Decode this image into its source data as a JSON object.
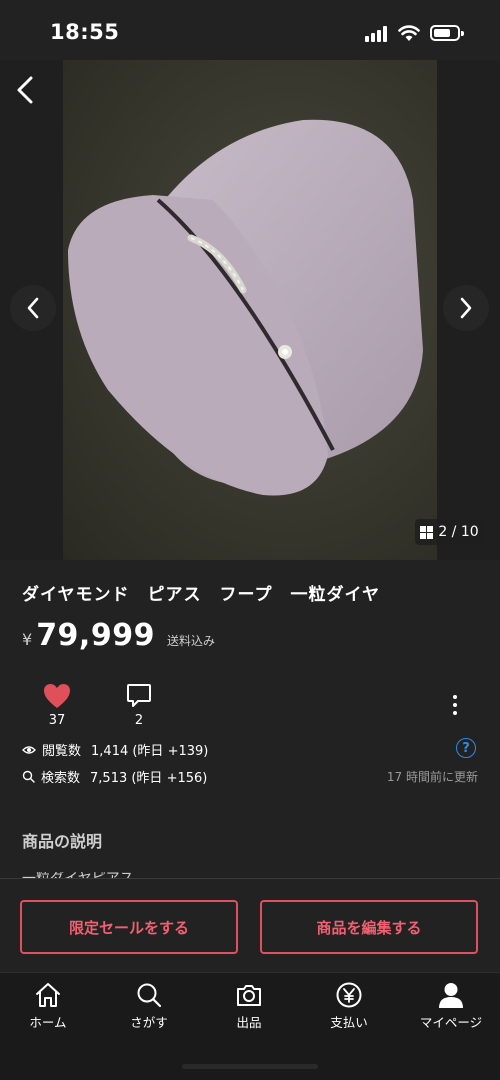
{
  "status_bar": {
    "time": "18:55"
  },
  "gallery": {
    "counter": "2 / 10"
  },
  "item": {
    "title": "ダイヤモンド　ピアス　フープ　一粒ダイヤ",
    "currency": "¥",
    "price": "79,999",
    "shipping": "送料込み"
  },
  "stats": {
    "likes": "37",
    "comments": "2",
    "views_label": "閲覧数",
    "views_value": "1,414 (昨日 +139)",
    "searches_label": "検索数",
    "searches_value": "7,513 (昨日 +156)",
    "updated": "17 時間前に更新"
  },
  "description": {
    "section_label": "商品の説明",
    "peek_text": "一粒ダイヤピアス"
  },
  "actions": {
    "sale_label": "限定セールをする",
    "edit_label": "商品を編集する"
  },
  "tabs": [
    {
      "label": "ホーム",
      "icon": "home-icon"
    },
    {
      "label": "さがす",
      "icon": "search-icon"
    },
    {
      "label": "出品",
      "icon": "camera-icon"
    },
    {
      "label": "支払い",
      "icon": "yen-icon"
    },
    {
      "label": "マイページ",
      "icon": "person-icon"
    }
  ],
  "colors": {
    "background": "#222222",
    "accent_red": "#e05060",
    "heart": "#e0505a",
    "help_blue": "#2b8be6"
  }
}
